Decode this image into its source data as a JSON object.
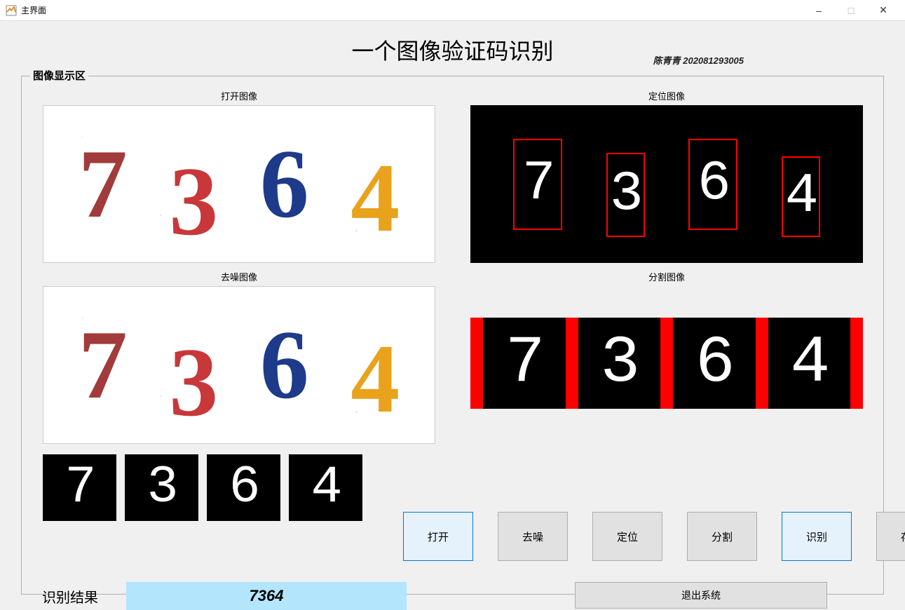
{
  "window": {
    "title": "主界面"
  },
  "header": {
    "title": "一个图像验证码识别",
    "author": "陈青青  202081293005"
  },
  "groupbox": {
    "title": "图像显示区"
  },
  "panels": {
    "open_label": "打开图像",
    "denoise_label": "去噪图像",
    "locate_label": "定位图像",
    "segment_label": "分割图像"
  },
  "captcha": {
    "digits": [
      "7",
      "3",
      "6",
      "4"
    ],
    "colors": [
      "#a23b3b",
      "#c8373a",
      "#1e3a8a",
      "#e9a21c"
    ]
  },
  "buttons": {
    "open": "打开",
    "denoise": "去噪",
    "locate": "定位",
    "segment": "分割",
    "recognize": "识别",
    "save": "存储",
    "exit": "退出系统"
  },
  "result": {
    "label": "识别结果",
    "value": "7364"
  }
}
